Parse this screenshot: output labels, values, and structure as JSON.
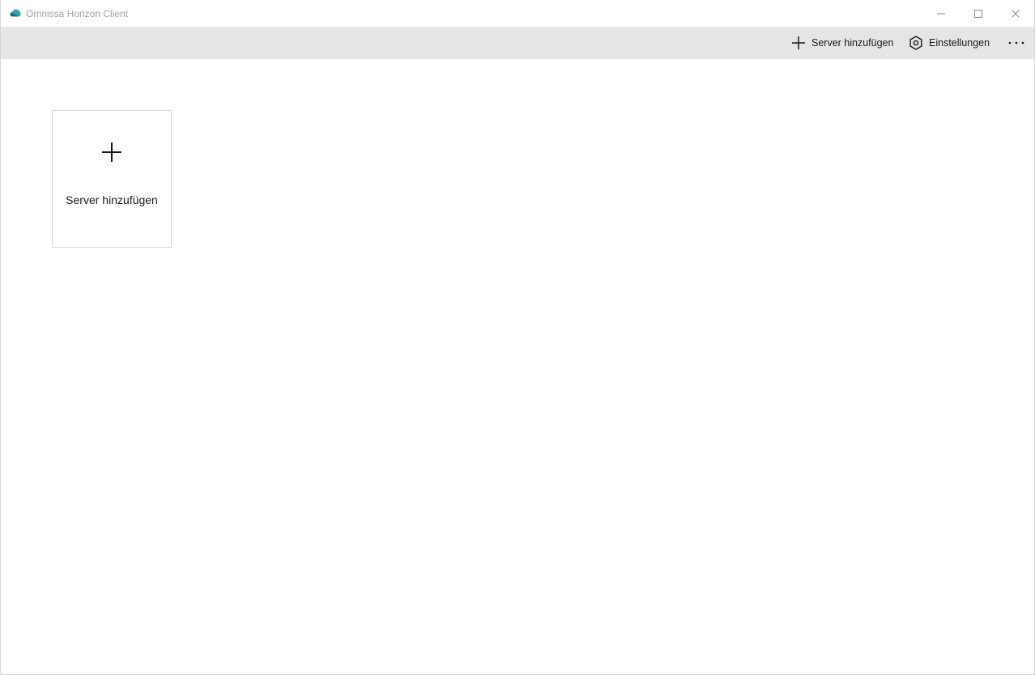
{
  "window": {
    "title": "Omnissa Horizon Client",
    "accent_color": "#1f8fa6"
  },
  "commandbar": {
    "add_server_label": "Server hinzufügen",
    "add_server_icon": "plus-icon",
    "settings_label": "Einstellungen",
    "settings_icon": "gear-icon",
    "more_icon": "more-horizontal-icon"
  },
  "tile": {
    "label": "Server hinzufügen",
    "icon": "plus-icon"
  },
  "window_controls": [
    "minimize-icon",
    "maximize-icon",
    "close-icon"
  ]
}
